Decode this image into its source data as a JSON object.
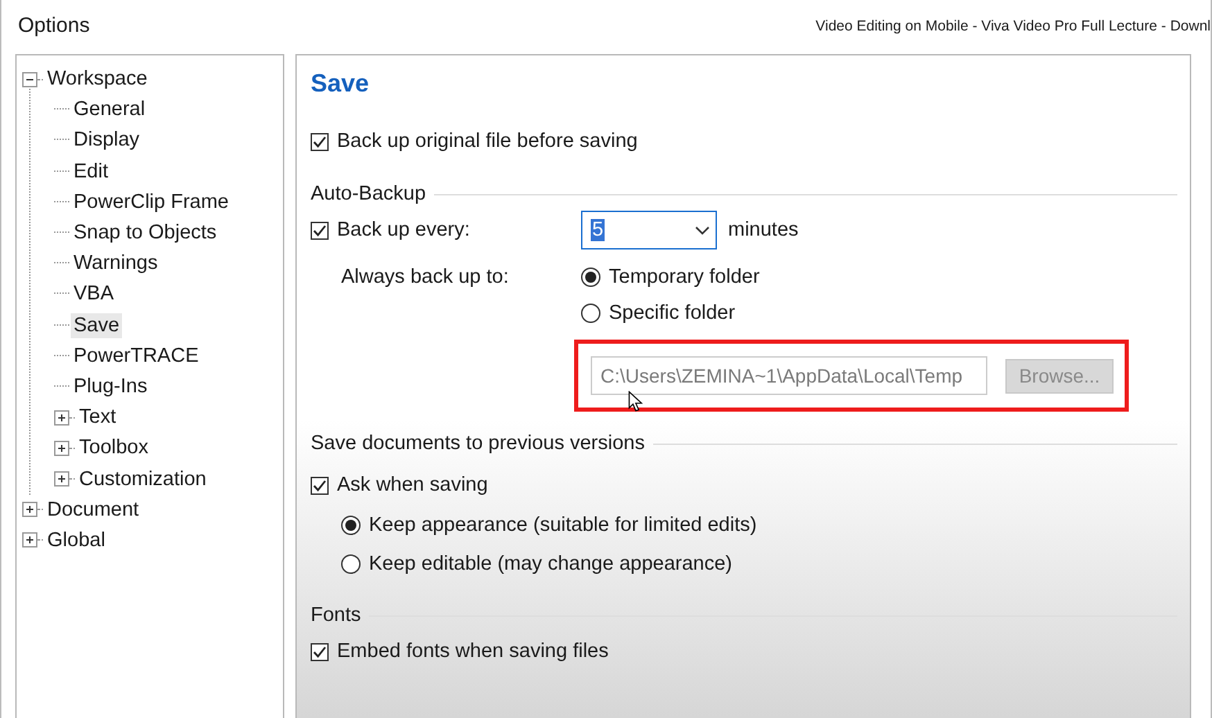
{
  "window": {
    "title": "Options",
    "overlay_caption": "Video Editing on Mobile - Viva Video Pro Full Lecture - Downl"
  },
  "tree": [
    {
      "label": "Workspace",
      "selected": false,
      "expanded": true,
      "children": [
        {
          "label": "General",
          "selected": false
        },
        {
          "label": "Display",
          "selected": false
        },
        {
          "label": "Edit",
          "selected": false
        },
        {
          "label": "PowerClip Frame",
          "selected": false
        },
        {
          "label": "Snap to Objects",
          "selected": false
        },
        {
          "label": "Warnings",
          "selected": false
        },
        {
          "label": "VBA",
          "selected": false
        },
        {
          "label": "Save",
          "selected": true
        },
        {
          "label": "PowerTRACE",
          "selected": false
        },
        {
          "label": "Plug-Ins",
          "selected": false
        },
        {
          "label": "Text",
          "selected": false,
          "expanded": false
        },
        {
          "label": "Toolbox",
          "selected": false,
          "expanded": false
        },
        {
          "label": "Customization",
          "selected": false,
          "expanded": false
        }
      ]
    },
    {
      "label": "Document",
      "selected": false,
      "expanded": false
    },
    {
      "label": "Global",
      "selected": false,
      "expanded": false
    }
  ],
  "page": {
    "title": "Save",
    "backup_original": {
      "label": "Back up original file before saving",
      "checked": true
    },
    "auto_backup": {
      "heading": "Auto-Backup",
      "every": {
        "label": "Back up every:",
        "checked": true,
        "value": "5",
        "unit": "minutes"
      },
      "location_label": "Always back up to:",
      "locations": [
        {
          "label": "Temporary folder",
          "selected": true
        },
        {
          "label": "Specific folder",
          "selected": false
        }
      ],
      "path": {
        "value": "C:\\Users\\ZEMINA~1\\AppData\\Local\\Temp",
        "disabled": true
      },
      "browse": {
        "label": "Browse...",
        "disabled": true
      }
    },
    "versions": {
      "heading": "Save documents to previous versions",
      "ask": {
        "label": "Ask when saving",
        "checked": true
      },
      "modes": [
        {
          "label": "Keep appearance (suitable for limited edits)",
          "selected": true
        },
        {
          "label": "Keep editable (may change appearance)",
          "selected": false
        }
      ]
    },
    "fonts": {
      "heading": "Fonts",
      "embed": {
        "label": "Embed fonts when saving files",
        "checked": true
      }
    }
  }
}
